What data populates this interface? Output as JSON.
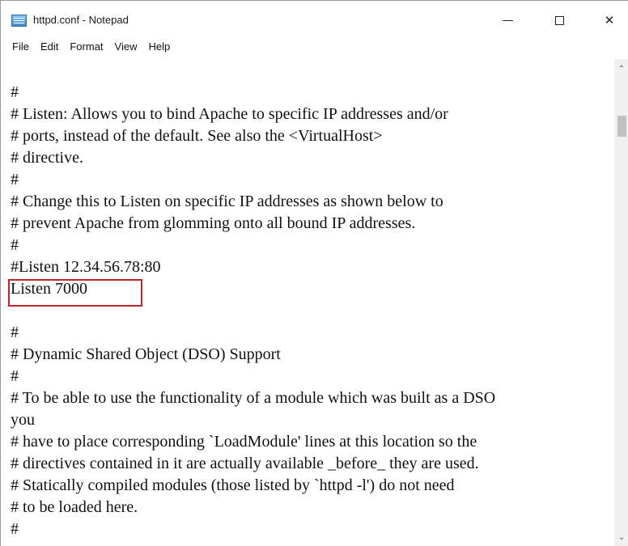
{
  "window": {
    "title": "httpd.conf - Notepad",
    "controls": {
      "minimize": "—",
      "maximize": "□",
      "close": "✕"
    }
  },
  "menu": [
    "File",
    "Edit",
    "Format",
    "View",
    "Help"
  ],
  "editor": {
    "text": "#\n# Listen: Allows you to bind Apache to specific IP addresses and/or\n# ports, instead of the default. See also the <VirtualHost>\n# directive.\n#\n# Change this to Listen on specific IP addresses as shown below to\n# prevent Apache from glomming onto all bound IP addresses.\n#\n#Listen 12.34.56.78:80\nListen 7000\n\n#\n# Dynamic Shared Object (DSO) Support\n#\n# To be able to use the functionality of a module which was built as a DSO\nyou\n# have to place corresponding `LoadModule' lines at this location so the\n# directives contained in it are actually available _before_ they are used.\n# Statically compiled modules (those listed by `httpd -l') do not need\n# to be loaded here.\n#",
    "highlight_color": "#c0252c"
  },
  "scrollbar": {
    "up_icon": "chevron-up-icon",
    "down_icon": "chevron-down-icon"
  }
}
